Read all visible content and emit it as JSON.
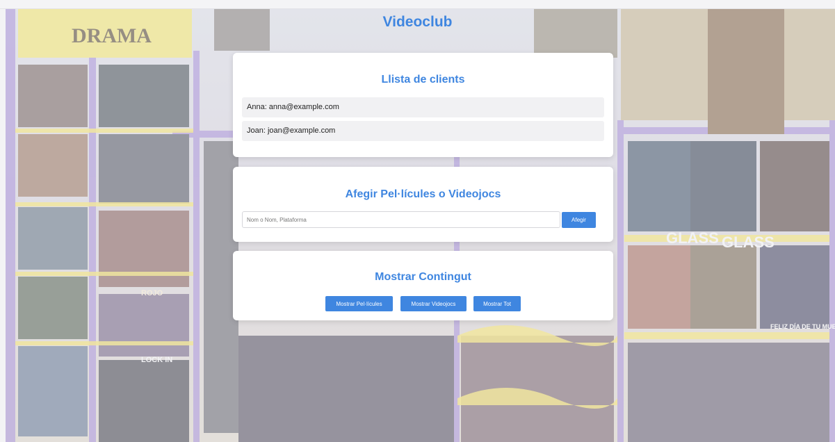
{
  "app": {
    "title": "Videoclub"
  },
  "clients": {
    "heading": "Llista de clients",
    "items": [
      "Anna: anna@example.com",
      "Joan: joan@example.com"
    ]
  },
  "add": {
    "heading": "Afegir Pel·lícules o Videojocs",
    "input_placeholder": "Nom o Nom, Plataforma",
    "input_value": "",
    "button_label": "Afegir"
  },
  "show": {
    "heading": "Mostrar Contingut",
    "buttons": [
      "Mostrar Pel·lícules",
      "Mostrar Videojocs",
      "Mostrar Tot"
    ]
  },
  "background": {
    "sign_text": "DRAMA",
    "tags": [
      "GLASS",
      "GLASS",
      "ROJO",
      "LOCK IN",
      "FELIZ DÍA DE TU MUERTE"
    ]
  },
  "colors": {
    "accent": "#3f86e0",
    "card_bg": "#ffffff",
    "row_bg": "#f1f1f3",
    "shelf": "#e6d35a",
    "rack": "#8b6fc9"
  }
}
